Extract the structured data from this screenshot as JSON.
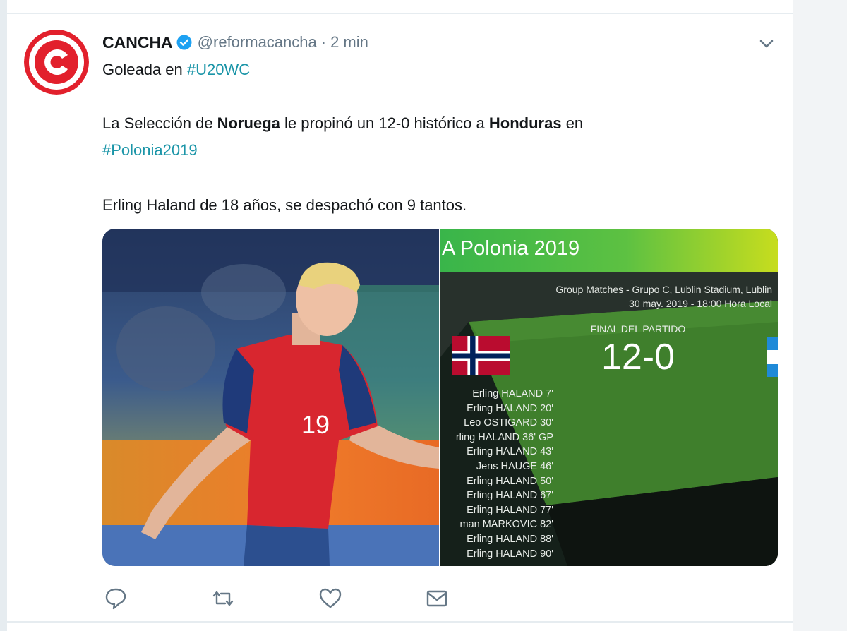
{
  "tweet": {
    "author_name": "CANCHA",
    "handle": "@reformacancha",
    "separator": "·",
    "time": "2 min",
    "line1_text": "Goleada en ",
    "line1_hashtag": "#U20WC",
    "line2_a": "La Selección de ",
    "line2_b": "Noruega",
    "line2_c": " le propinó un 12-0 histórico a ",
    "line2_d": "Honduras",
    "line2_e": " en",
    "line3_hashtag": "#Polonia2019",
    "line4": "Erling Haland de 18 años, se despachó con 9 tantos."
  },
  "graphic": {
    "banner": "A Polonia 2019",
    "match_line1": "Group Matches - Grupo C, Lublin Stadium, Lublin",
    "match_line2": "30 may. 2019 - 18:00 Hora Local",
    "final_label": "FINAL DEL PARTIDO",
    "score": "12-0",
    "scorers": [
      "Erling HALAND 7'",
      "Erling HALAND 20'",
      "Leo OSTIGARD 30'",
      "rling HALAND 36' GP",
      "Erling HALAND 43'",
      "Jens HAUGE 46'",
      "Erling HALAND 50'",
      "Erling HALAND 67'",
      "Erling HALAND 77'",
      "man MARKOVIC 82'",
      "Erling HALAND 88'",
      "Erling HALAND 90'"
    ],
    "player_shirt_number": "19"
  },
  "colors": {
    "brand_red": "#e2202c",
    "hashtag": "#1b95a8",
    "verified": "#1da1f2",
    "muted_text": "#657786"
  },
  "icons": {
    "reply": "reply-icon",
    "retweet": "retweet-icon",
    "like": "heart-icon",
    "dm": "envelope-icon",
    "menu": "chevron-down-icon"
  }
}
